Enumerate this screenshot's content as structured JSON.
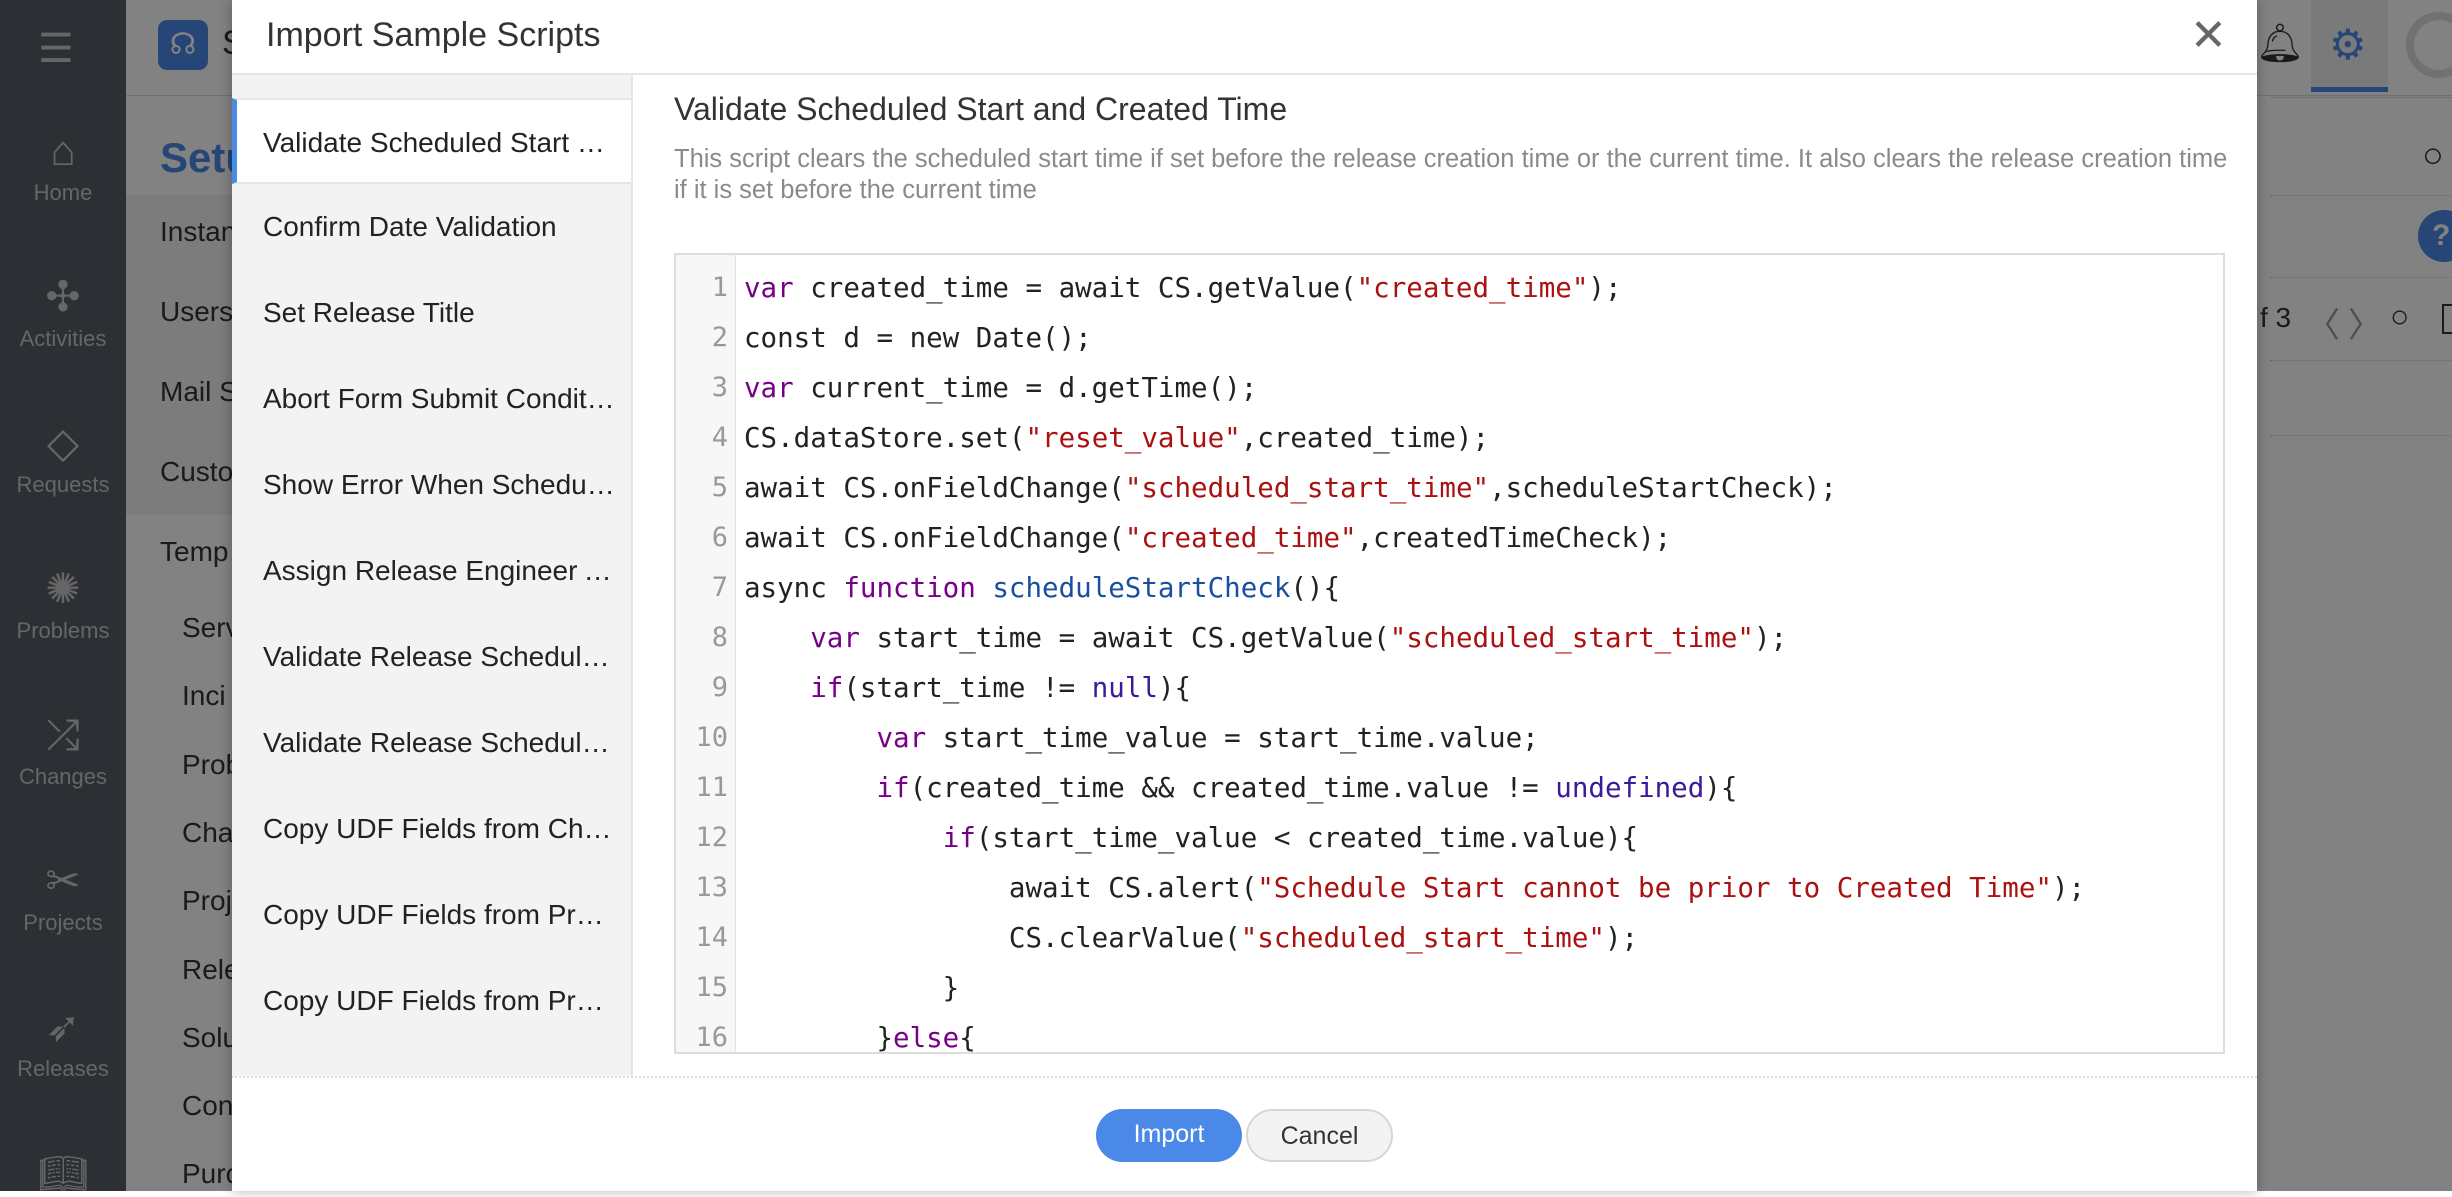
{
  "nav": {
    "items": [
      {
        "label": "Home",
        "icon": "home-icon"
      },
      {
        "label": "Activities",
        "icon": "activities-icon"
      },
      {
        "label": "Requests",
        "icon": "ticket-icon"
      },
      {
        "label": "Problems",
        "icon": "bug-icon"
      },
      {
        "label": "Changes",
        "icon": "shuffle-icon"
      },
      {
        "label": "Projects",
        "icon": "projects-icon"
      },
      {
        "label": "Releases",
        "icon": "rocket-icon"
      }
    ]
  },
  "background": {
    "app_name": "S",
    "page_title": "Setu",
    "items": [
      "Instan",
      "Users",
      "Mail S",
      "Custo",
      "Temp"
    ],
    "sub_items": [
      "Serv",
      "Inci",
      "Prob",
      "Cha",
      "Proj",
      "Rele",
      "Solu",
      "Con",
      "Purc"
    ],
    "page_count": "f 3"
  },
  "modal": {
    "title": "Import Sample Scripts",
    "scripts": [
      "Validate Scheduled Start and Created Time",
      "Confirm Date Validation",
      "Set Release Title",
      "Abort Form Submit Conditionally",
      "Show Error When Scheduled Dates Invalid",
      "Assign Release Engineer Automatically",
      "Validate Release Scheduled Start",
      "Validate Release Scheduled End",
      "Copy UDF Fields from Change",
      "Copy UDF Fields from Project",
      "Copy UDF Fields from Problem"
    ],
    "selected_index": 0,
    "detail": {
      "heading": "Validate Scheduled Start and Created Time",
      "description": "This script clears the scheduled start time if set before the release creation time or the current time. It also clears the release creation time if it is set before the current time"
    },
    "code_lines": [
      [
        [
          "var",
          "k"
        ],
        [
          " created_time = await CS.getValue(",
          ""
        ],
        [
          "\"created_time\"",
          "s"
        ],
        [
          ");",
          ""
        ]
      ],
      [
        [
          "const d = new Date();",
          ""
        ]
      ],
      [
        [
          "var",
          "k"
        ],
        [
          " current_time = d.getTime();",
          ""
        ]
      ],
      [
        [
          "CS.dataStore.set(",
          ""
        ],
        [
          "\"reset_value\"",
          "s"
        ],
        [
          ",created_time);",
          ""
        ]
      ],
      [
        [
          "await CS.onFieldChange(",
          ""
        ],
        [
          "\"scheduled_start_time\"",
          "s"
        ],
        [
          ",scheduleStartCheck);",
          ""
        ]
      ],
      [
        [
          "await CS.onFieldChange(",
          ""
        ],
        [
          "\"created_time\"",
          "s"
        ],
        [
          ",createdTimeCheck);",
          ""
        ]
      ],
      [
        [
          "async ",
          ""
        ],
        [
          "function",
          "k"
        ],
        [
          " ",
          ""
        ],
        [
          "scheduleStartCheck",
          "d"
        ],
        [
          "(){",
          ""
        ]
      ],
      [
        [
          "    ",
          ""
        ],
        [
          "var",
          "k"
        ],
        [
          " start_time = await CS.getValue(",
          ""
        ],
        [
          "\"scheduled_start_time\"",
          "s"
        ],
        [
          ");",
          ""
        ]
      ],
      [
        [
          "    ",
          ""
        ],
        [
          "if",
          "k"
        ],
        [
          "(start_time != ",
          ""
        ],
        [
          "null",
          "a"
        ],
        [
          "){",
          ""
        ]
      ],
      [
        [
          "        ",
          ""
        ],
        [
          "var",
          "k"
        ],
        [
          " start_time_value = start_time.value;",
          ""
        ]
      ],
      [
        [
          "        ",
          ""
        ],
        [
          "if",
          "k"
        ],
        [
          "(created_time && created_time.value != ",
          ""
        ],
        [
          "undefined",
          "a"
        ],
        [
          "){",
          ""
        ]
      ],
      [
        [
          "            ",
          ""
        ],
        [
          "if",
          "k"
        ],
        [
          "(start_time_value < created_time.value){",
          ""
        ]
      ],
      [
        [
          "                await CS.alert(",
          ""
        ],
        [
          "\"Schedule Start cannot be prior to Created Time\"",
          "s"
        ],
        [
          ");",
          ""
        ]
      ],
      [
        [
          "                CS.clearValue(",
          ""
        ],
        [
          "\"scheduled_start_time\"",
          "s"
        ],
        [
          ");",
          ""
        ]
      ],
      [
        [
          "            }",
          ""
        ]
      ],
      [
        [
          "        }",
          ""
        ],
        [
          "else",
          "k"
        ],
        [
          "{",
          ""
        ]
      ]
    ],
    "import_label": "Import",
    "cancel_label": "Cancel",
    "close_icon": "close-icon"
  },
  "colors": {
    "accent": "#4a89e8",
    "keyword": "#770088",
    "string": "#aa1111"
  }
}
